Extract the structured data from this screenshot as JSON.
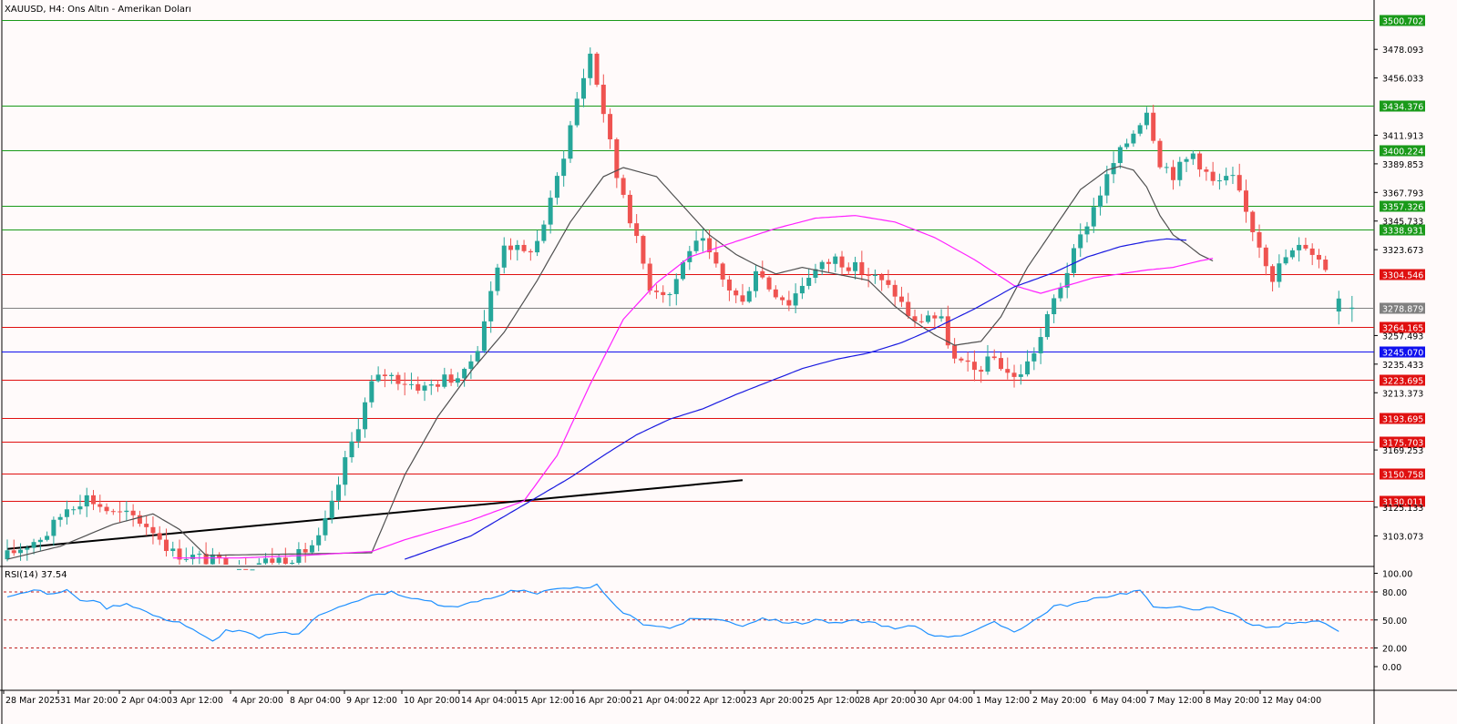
{
  "title": "XAUUSD, H4:  Ons Altın - Amerikan Doları",
  "rsi_label": "RSI(14) 37.54",
  "colors": {
    "bull": "#26a69a",
    "bear": "#ef5350",
    "support": "#e01010",
    "resistance": "#1a9a1a",
    "blue_level": "#1010ee",
    "current_price": "#808080",
    "ma_fast": "#505050",
    "ma_mid": "#ff20ff",
    "ma_slow": "#1a1ae0",
    "trend": "#000000",
    "rsi_line": "#1e90ff",
    "rsi_levels": "#c02020"
  },
  "chart_data": [
    {
      "type": "candlestick",
      "symbol": "XAUUSD",
      "timeframe": "H4",
      "ylim": [
        3085,
        3510
      ],
      "y_ticks": [
        "3478.093",
        "3456.033",
        "3411.913",
        "3389.853",
        "3367.793",
        "3345.733",
        "3323.673",
        "3257.493",
        "3235.433",
        "3213.373",
        "3169.253",
        "3125.133",
        "3103.073"
      ],
      "x_labels": [
        "28 Mar 2025",
        "31 Mar 20:00",
        "2 Apr 04:00",
        "3 Apr 12:00",
        "4 Apr 20:00",
        "8 Apr 04:00",
        "9 Apr 12:00",
        "10 Apr 20:00",
        "14 Apr 04:00",
        "15 Apr 12:00",
        "16 Apr 20:00",
        "21 Apr 04:00",
        "22 Apr 12:00",
        "23 Apr 20:00",
        "25 Apr 12:00",
        "28 Apr 20:00",
        "30 Apr 04:00",
        "1 May 12:00",
        "2 May 20:00",
        "6 May 04:00",
        "7 May 12:00",
        "8 May 20:00",
        "12 May 04:00"
      ],
      "levels": [
        {
          "value": "3500.702",
          "kind": "resistance"
        },
        {
          "value": "3434.376",
          "kind": "resistance"
        },
        {
          "value": "3400.224",
          "kind": "resistance"
        },
        {
          "value": "3357.326",
          "kind": "resistance"
        },
        {
          "value": "3338.931",
          "kind": "resistance"
        },
        {
          "value": "3304.546",
          "kind": "support"
        },
        {
          "value": "3278.879",
          "kind": "current_price"
        },
        {
          "value": "3264.165",
          "kind": "support"
        },
        {
          "value": "3245.070",
          "kind": "blue_level"
        },
        {
          "value": "3223.695",
          "kind": "support"
        },
        {
          "value": "3193.695",
          "kind": "support"
        },
        {
          "value": "3175.703",
          "kind": "support"
        },
        {
          "value": "3150.758",
          "kind": "support"
        },
        {
          "value": "3130.011",
          "kind": "support"
        }
      ],
      "trendline": {
        "from": [
          0,
          3093
        ],
        "to": [
          111,
          3146
        ]
      },
      "anchors": {
        "close": [
          [
            0,
            3088
          ],
          [
            6,
            3105
          ],
          [
            9,
            3125
          ],
          [
            12,
            3133
          ],
          [
            16,
            3120
          ],
          [
            19,
            3118
          ],
          [
            22,
            3108
          ],
          [
            25,
            3090
          ],
          [
            35,
            3080
          ],
          [
            44,
            3088
          ],
          [
            47,
            3100
          ],
          [
            49,
            3126
          ],
          [
            51,
            3160
          ],
          [
            53,
            3190
          ],
          [
            55,
            3220
          ],
          [
            57,
            3228
          ],
          [
            60,
            3222
          ],
          [
            63,
            3217
          ],
          [
            66,
            3224
          ],
          [
            69,
            3227
          ],
          [
            71,
            3250
          ],
          [
            73,
            3290
          ],
          [
            75,
            3330
          ],
          [
            78,
            3320
          ],
          [
            80,
            3330
          ],
          [
            82,
            3360
          ],
          [
            84,
            3398
          ],
          [
            86,
            3440
          ],
          [
            88,
            3475
          ],
          [
            90,
            3430
          ],
          [
            92,
            3380
          ],
          [
            93,
            3368
          ],
          [
            95,
            3330
          ],
          [
            97,
            3296
          ],
          [
            100,
            3290
          ],
          [
            103,
            3325
          ],
          [
            105,
            3328
          ],
          [
            108,
            3300
          ],
          [
            111,
            3282
          ],
          [
            113,
            3310
          ],
          [
            115,
            3295
          ],
          [
            118,
            3283
          ],
          [
            121,
            3305
          ],
          [
            125,
            3317
          ],
          [
            127,
            3312
          ],
          [
            131,
            3302
          ],
          [
            134,
            3290
          ],
          [
            137,
            3266
          ],
          [
            139,
            3274
          ],
          [
            141,
            3268
          ],
          [
            143,
            3238
          ],
          [
            146,
            3230
          ],
          [
            149,
            3240
          ],
          [
            152,
            3224
          ],
          [
            154,
            3236
          ],
          [
            156,
            3256
          ],
          [
            158,
            3285
          ],
          [
            160,
            3308
          ],
          [
            163,
            3345
          ],
          [
            165,
            3368
          ],
          [
            167,
            3390
          ],
          [
            170,
            3415
          ],
          [
            172,
            3432
          ],
          [
            174,
            3392
          ],
          [
            176,
            3382
          ],
          [
            179,
            3398
          ],
          [
            182,
            3375
          ],
          [
            185,
            3378
          ],
          [
            187,
            3352
          ],
          [
            189,
            3328
          ],
          [
            191,
            3303
          ],
          [
            193,
            3318
          ],
          [
            196,
            3328
          ],
          [
            198,
            3316
          ],
          [
            199,
            3310
          ]
        ],
        "ma_fast": [
          [
            0,
            3085
          ],
          [
            8,
            3095
          ],
          [
            16,
            3112
          ],
          [
            22,
            3120
          ],
          [
            26,
            3108
          ],
          [
            30,
            3088
          ],
          [
            55,
            3090
          ],
          [
            60,
            3150
          ],
          [
            65,
            3195
          ],
          [
            70,
            3230
          ],
          [
            75,
            3260
          ],
          [
            80,
            3300
          ],
          [
            85,
            3345
          ],
          [
            90,
            3380
          ],
          [
            93,
            3387
          ],
          [
            98,
            3380
          ],
          [
            101,
            3363
          ],
          [
            106,
            3335
          ],
          [
            110,
            3320
          ],
          [
            113,
            3312
          ],
          [
            116,
            3305
          ],
          [
            120,
            3310
          ],
          [
            125,
            3305
          ],
          [
            130,
            3300
          ],
          [
            134,
            3280
          ],
          [
            137,
            3268
          ],
          [
            140,
            3258
          ],
          [
            143,
            3250
          ],
          [
            147,
            3253
          ],
          [
            150,
            3272
          ],
          [
            154,
            3310
          ],
          [
            158,
            3340
          ],
          [
            162,
            3370
          ],
          [
            166,
            3385
          ],
          [
            168,
            3388
          ],
          [
            170,
            3385
          ],
          [
            172,
            3372
          ],
          [
            174,
            3350
          ],
          [
            176,
            3335
          ],
          [
            178,
            3328
          ],
          [
            180,
            3320
          ],
          [
            182,
            3315
          ]
        ],
        "ma_mid": [
          [
            25,
            3086
          ],
          [
            35,
            3086
          ],
          [
            45,
            3088
          ],
          [
            55,
            3091
          ],
          [
            60,
            3100
          ],
          [
            70,
            3115
          ],
          [
            78,
            3130
          ],
          [
            83,
            3165
          ],
          [
            88,
            3220
          ],
          [
            93,
            3270
          ],
          [
            98,
            3298
          ],
          [
            103,
            3318
          ],
          [
            110,
            3330
          ],
          [
            116,
            3340
          ],
          [
            122,
            3348
          ],
          [
            128,
            3350
          ],
          [
            134,
            3345
          ],
          [
            140,
            3333
          ],
          [
            146,
            3316
          ],
          [
            152,
            3296
          ],
          [
            156,
            3290
          ],
          [
            160,
            3296
          ],
          [
            164,
            3302
          ],
          [
            168,
            3305
          ],
          [
            172,
            3308
          ],
          [
            176,
            3310
          ],
          [
            180,
            3315
          ],
          [
            182,
            3317
          ]
        ],
        "ma_slow": [
          [
            60,
            3085
          ],
          [
            70,
            3103
          ],
          [
            80,
            3133
          ],
          [
            85,
            3148
          ],
          [
            90,
            3165
          ],
          [
            95,
            3181
          ],
          [
            100,
            3193
          ],
          [
            105,
            3201
          ],
          [
            110,
            3212
          ],
          [
            115,
            3222
          ],
          [
            120,
            3232
          ],
          [
            125,
            3239
          ],
          [
            130,
            3244
          ],
          [
            135,
            3252
          ],
          [
            140,
            3263
          ],
          [
            146,
            3278
          ],
          [
            152,
            3295
          ],
          [
            158,
            3306
          ],
          [
            163,
            3318
          ],
          [
            168,
            3326
          ],
          [
            172,
            3330
          ],
          [
            175,
            3332
          ],
          [
            178,
            3331
          ]
        ],
        "rsi": [
          [
            0,
            76
          ],
          [
            4,
            82
          ],
          [
            7,
            77
          ],
          [
            9,
            83
          ],
          [
            11,
            70
          ],
          [
            13,
            72
          ],
          [
            15,
            63
          ],
          [
            18,
            68
          ],
          [
            20,
            62
          ],
          [
            23,
            52
          ],
          [
            26,
            48
          ],
          [
            29,
            35
          ],
          [
            31,
            27
          ],
          [
            33,
            39
          ],
          [
            36,
            37
          ],
          [
            38,
            30
          ],
          [
            40,
            36
          ],
          [
            44,
            35
          ],
          [
            47,
            55
          ],
          [
            50,
            65
          ],
          [
            53,
            70
          ],
          [
            55,
            76
          ],
          [
            58,
            80
          ],
          [
            60,
            74
          ],
          [
            63,
            72
          ],
          [
            66,
            64
          ],
          [
            69,
            66
          ],
          [
            71,
            70
          ],
          [
            74,
            75
          ],
          [
            76,
            82
          ],
          [
            78,
            82
          ],
          [
            80,
            78
          ],
          [
            82,
            82
          ],
          [
            85,
            83
          ],
          [
            87,
            85
          ],
          [
            89,
            87
          ],
          [
            91,
            70
          ],
          [
            93,
            58
          ],
          [
            96,
            46
          ],
          [
            98,
            44
          ],
          [
            100,
            41
          ],
          [
            103,
            50
          ],
          [
            106,
            52
          ],
          [
            109,
            48
          ],
          [
            111,
            44
          ],
          [
            114,
            52
          ],
          [
            117,
            48
          ],
          [
            120,
            46
          ],
          [
            122,
            51
          ],
          [
            125,
            46
          ],
          [
            128,
            49
          ],
          [
            131,
            47
          ],
          [
            134,
            40
          ],
          [
            137,
            44
          ],
          [
            139,
            36
          ],
          [
            141,
            32
          ],
          [
            144,
            34
          ],
          [
            147,
            41
          ],
          [
            149,
            47
          ],
          [
            152,
            38
          ],
          [
            154,
            45
          ],
          [
            156,
            54
          ],
          [
            158,
            65
          ],
          [
            160,
            66
          ],
          [
            163,
            70
          ],
          [
            165,
            74
          ],
          [
            167,
            77
          ],
          [
            169,
            79
          ],
          [
            171,
            82
          ],
          [
            173,
            63
          ],
          [
            176,
            65
          ],
          [
            179,
            60
          ],
          [
            182,
            64
          ],
          [
            185,
            57
          ],
          [
            187,
            47
          ],
          [
            189,
            44
          ],
          [
            191,
            41
          ],
          [
            193,
            46
          ],
          [
            196,
            47
          ],
          [
            198,
            48
          ],
          [
            199,
            45
          ],
          [
            201,
            37
          ]
        ]
      },
      "last_price": 3278.879
    },
    {
      "type": "line",
      "name": "RSI(14)",
      "value": 37.54,
      "ylim": [
        0,
        100
      ],
      "y_ticks": [
        "100.00",
        "80.00",
        "50.00",
        "20.00",
        "0.00"
      ],
      "levels": [
        80,
        50,
        20
      ]
    }
  ]
}
